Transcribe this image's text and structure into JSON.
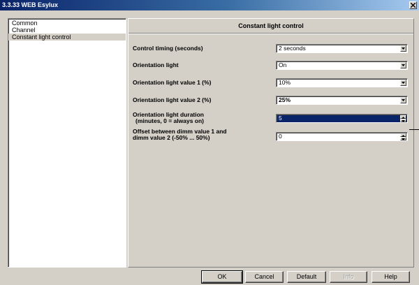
{
  "window": {
    "title": "3.3.33 WEB Esylux"
  },
  "sidebar": {
    "items": [
      {
        "label": "Common"
      },
      {
        "label": "Channel"
      },
      {
        "label": "Constant light control"
      }
    ]
  },
  "panel": {
    "title": "Constant light control",
    "fields": [
      {
        "label": "Control timing (seconds)",
        "value": "2 seconds",
        "control": "dropdown"
      },
      {
        "label": "Orientation light",
        "value": "On",
        "control": "dropdown"
      },
      {
        "label": "Orientation light value 1 (%)",
        "value": "10%",
        "control": "dropdown"
      },
      {
        "label": "Orientation light value 2 (%)",
        "value": "25%",
        "control": "dropdown"
      },
      {
        "label_line1": "Orientation light duration",
        "label_line2": "(minutes, 0 = always on)",
        "value": "5",
        "control": "spinner"
      },
      {
        "label_line1": "Offset between dimm value 1 and",
        "label_line2": "dimm value 2 (-50% ... 50%)",
        "value": "0",
        "control": "spinner"
      }
    ]
  },
  "buttons": {
    "ok": "OK",
    "cancel": "Cancel",
    "default": "Default",
    "info": "Info",
    "help": "Help"
  },
  "icons": {
    "close": "close-icon",
    "dropdown": "chevron-down-icon",
    "spin_up": "spin-up-icon",
    "spin_down": "spin-down-icon"
  },
  "colors": {
    "titlebar_start": "#0a246a",
    "titlebar_end": "#a6caf0",
    "dialog_bg": "#d4d0c8",
    "selection": "#0a246a"
  }
}
